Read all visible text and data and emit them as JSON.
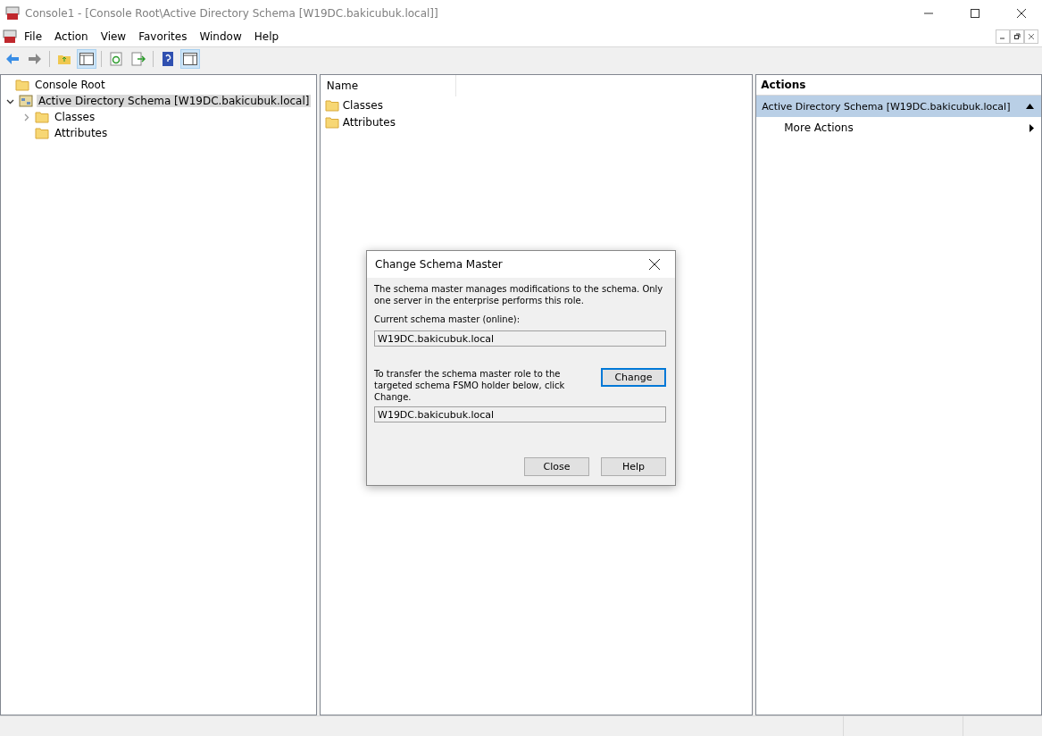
{
  "window": {
    "title": "Console1 - [Console Root\\Active Directory Schema [W19DC.bakicubuk.local]]"
  },
  "menu": [
    "File",
    "Action",
    "View",
    "Favorites",
    "Window",
    "Help"
  ],
  "tree": [
    {
      "label": "Console Root",
      "selected": false,
      "children": [
        {
          "label": "Active Directory Schema [W19DC.bakicubuk.local]",
          "selected": true,
          "expanded": true,
          "children": [
            {
              "label": "Classes",
              "selected": false,
              "expanded": false
            },
            {
              "label": "Attributes",
              "selected": false
            }
          ]
        }
      ]
    }
  ],
  "list": {
    "column": "Name",
    "items": [
      "Classes",
      "Attributes"
    ]
  },
  "actions": {
    "header": "Actions",
    "section": {
      "label": "Active Directory Schema [W19DC.bakicubuk.local]",
      "expanded": true
    },
    "items": [
      "More Actions"
    ]
  },
  "dialog": {
    "title": "Change Schema Master",
    "description": "The schema master manages modifications to the schema. Only one server in the enterprise performs this role.",
    "current_label": "Current schema master (online):",
    "current_value": "W19DC.bakicubuk.local",
    "transfer_text": "To transfer the schema master role to the targeted schema FSMO holder below, click Change.",
    "target_value": "W19DC.bakicubuk.local",
    "buttons": [
      {
        "label": "Change",
        "focused": true
      },
      {
        "label": "Close",
        "focused": false
      },
      {
        "label": "Help",
        "focused": false
      }
    ]
  }
}
